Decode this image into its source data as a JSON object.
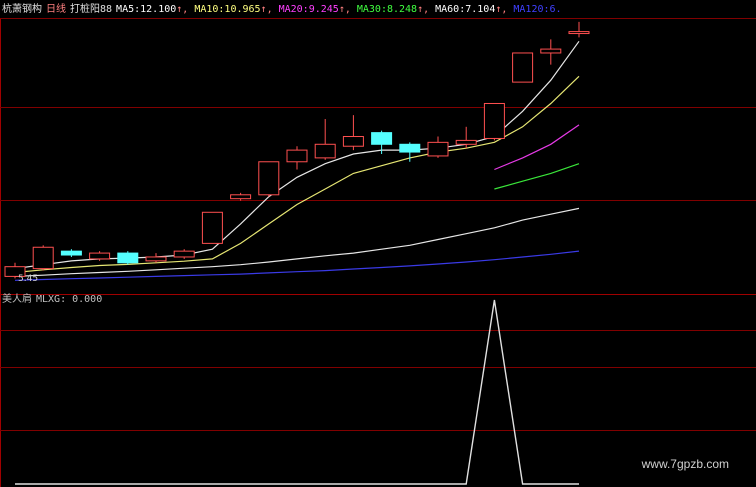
{
  "header": {
    "stock_name": "杭萧钢构",
    "period": "日线",
    "indicator_name": "打桩阳88",
    "ma_items": [
      {
        "label": "MA5: ",
        "value": "12.100",
        "arrow": "↑,",
        "color": "#ffffff"
      },
      {
        "label": "MA10: ",
        "value": "10.965",
        "arrow": "↑,",
        "color": "#ffff80"
      },
      {
        "label": "MA20: ",
        "value": "9.245",
        "arrow": "↑,",
        "color": "#ff40ff"
      },
      {
        "label": "MA30: ",
        "value": "8.248",
        "arrow": "↑,",
        "color": "#40ff40"
      },
      {
        "label": "MA60: ",
        "value": "7.104",
        "arrow": "↑,",
        "color": "#ffffff"
      },
      {
        "label": "MA120: ",
        "value": "6.",
        "arrow": "",
        "color": "#4040ff"
      }
    ]
  },
  "sub_panel": {
    "name": "美人肩",
    "indicator_label": "MLXG: ",
    "indicator_value": "0.000"
  },
  "price_label": "5.45",
  "watermark": "www.7gpzb.com",
  "colors": {
    "background": "#000000",
    "grid": "#800000",
    "panel_border": "#a00000",
    "up_candle": "#ff5050",
    "down_candle": "#54ffff",
    "sub_line": "#e0e0e0"
  },
  "chart_data": [
    {
      "type": "candlestick",
      "title": "",
      "candles": [
        {
          "o": 5.35,
          "c": 5.6,
          "h": 5.7,
          "l": 5.3
        },
        {
          "o": 5.55,
          "c": 6.1,
          "h": 6.15,
          "l": 5.5
        },
        {
          "o": 6.0,
          "c": 5.9,
          "h": 6.05,
          "l": 5.85
        },
        {
          "o": 5.8,
          "c": 5.95,
          "h": 6.0,
          "l": 5.75
        },
        {
          "o": 5.95,
          "c": 5.7,
          "h": 6.0,
          "l": 5.65
        },
        {
          "o": 5.75,
          "c": 5.85,
          "h": 5.95,
          "l": 5.7
        },
        {
          "o": 5.85,
          "c": 6.0,
          "h": 6.05,
          "l": 5.8
        },
        {
          "o": 6.2,
          "c": 7.0,
          "h": 7.0,
          "l": 6.2
        },
        {
          "o": 7.35,
          "c": 7.45,
          "h": 7.5,
          "l": 7.3
        },
        {
          "o": 7.45,
          "c": 8.3,
          "h": 8.3,
          "l": 7.4
        },
        {
          "o": 8.3,
          "c": 8.6,
          "h": 8.7,
          "l": 8.1
        },
        {
          "o": 8.4,
          "c": 8.75,
          "h": 9.4,
          "l": 8.35
        },
        {
          "o": 8.7,
          "c": 8.95,
          "h": 9.5,
          "l": 8.6
        },
        {
          "o": 9.05,
          "c": 8.75,
          "h": 9.1,
          "l": 8.5
        },
        {
          "o": 8.75,
          "c": 8.55,
          "h": 8.8,
          "l": 8.3
        },
        {
          "o": 8.45,
          "c": 8.8,
          "h": 8.95,
          "l": 8.4
        },
        {
          "o": 8.75,
          "c": 8.85,
          "h": 9.2,
          "l": 8.65
        },
        {
          "o": 8.9,
          "c": 9.8,
          "h": 9.8,
          "l": 8.85
        },
        {
          "o": 10.35,
          "c": 11.1,
          "h": 11.1,
          "l": 10.35
        },
        {
          "o": 11.1,
          "c": 11.2,
          "h": 11.45,
          "l": 10.8
        },
        {
          "o": 11.6,
          "c": 11.65,
          "h": 11.9,
          "l": 11.5
        }
      ],
      "ma_series": [
        {
          "name": "MA5",
          "color": "#ffffff",
          "values": [
            5.55,
            5.65,
            5.75,
            5.8,
            5.82,
            5.85,
            5.9,
            6.05,
            6.7,
            7.4,
            7.9,
            8.25,
            8.5,
            8.6,
            8.6,
            8.65,
            8.75,
            8.95,
            9.6,
            10.4,
            11.4
          ]
        },
        {
          "name": "MA10",
          "color": "#ffff80",
          "values": [
            5.45,
            5.52,
            5.58,
            5.63,
            5.66,
            5.7,
            5.74,
            5.8,
            6.2,
            6.7,
            7.2,
            7.6,
            8.0,
            8.2,
            8.4,
            8.55,
            8.65,
            8.8,
            9.2,
            9.8,
            10.5
          ]
        },
        {
          "name": "MA20",
          "color": "#ff40ff",
          "values": [
            null,
            null,
            null,
            null,
            null,
            null,
            null,
            null,
            null,
            null,
            null,
            null,
            null,
            null,
            null,
            null,
            null,
            8.1,
            8.4,
            8.75,
            9.25
          ]
        },
        {
          "name": "MA30",
          "color": "#40ff40",
          "values": [
            null,
            null,
            null,
            null,
            null,
            null,
            null,
            null,
            null,
            null,
            null,
            null,
            null,
            null,
            null,
            null,
            null,
            7.6,
            7.8,
            8.0,
            8.25
          ]
        },
        {
          "name": "MA60",
          "color": "#ffffff",
          "values": [
            5.35,
            5.38,
            5.42,
            5.45,
            5.48,
            5.52,
            5.56,
            5.6,
            5.65,
            5.72,
            5.8,
            5.88,
            5.95,
            6.05,
            6.15,
            6.3,
            6.45,
            6.6,
            6.8,
            6.95,
            7.1
          ]
        },
        {
          "name": "MA120",
          "color": "#4040ff",
          "values": [
            5.25,
            5.27,
            5.29,
            5.31,
            5.33,
            5.35,
            5.37,
            5.39,
            5.41,
            5.44,
            5.47,
            5.5,
            5.54,
            5.58,
            5.62,
            5.67,
            5.72,
            5.78,
            5.85,
            5.92,
            6.0
          ]
        }
      ]
    },
    {
      "type": "line",
      "title": "",
      "series": [
        {
          "name": "MLXG",
          "values": [
            0,
            0,
            0,
            0,
            0,
            0,
            0,
            0,
            0,
            0,
            0,
            0,
            0,
            0,
            0,
            0,
            0,
            1,
            0,
            0,
            0
          ]
        }
      ],
      "ylim": [
        0,
        1
      ]
    }
  ]
}
